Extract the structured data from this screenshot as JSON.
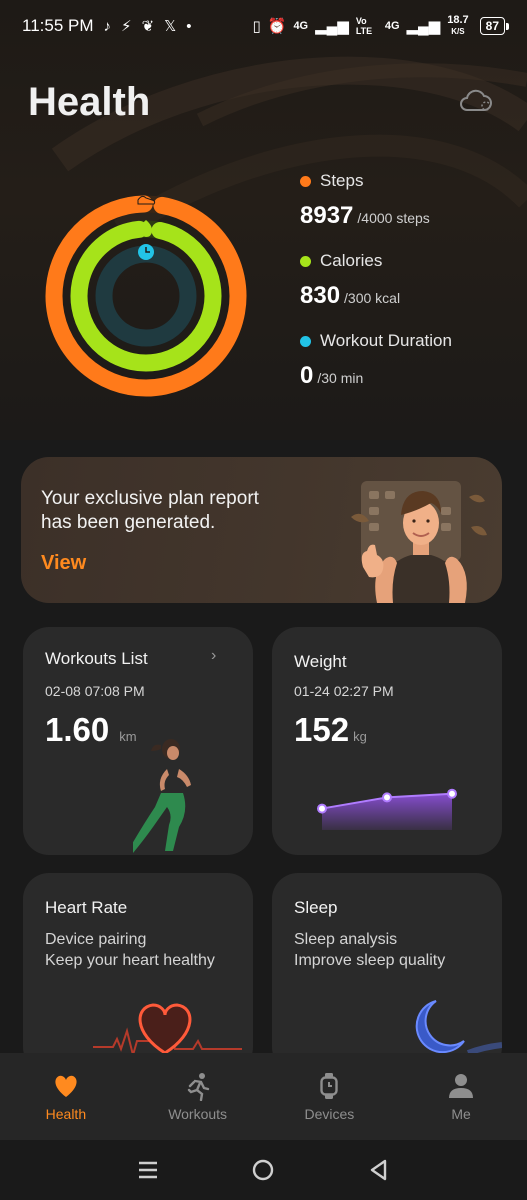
{
  "status_bar": {
    "time": "11:55 PM",
    "left_icons": [
      "tiktok-icon",
      "bolt-icon",
      "leaf-icon",
      "x-icon"
    ],
    "dot": "•",
    "net_4g_a": "4G",
    "volte": "Vo LTE",
    "net_4g_b": "4G",
    "speed": "18.7",
    "speed_unit": "K/S",
    "battery": "87"
  },
  "header": {
    "title": "Health"
  },
  "rings": {
    "steps_color": "#ff7a1a",
    "calories_color": "#a6e31a",
    "workout_color": "#22c3e6",
    "steps_progress": 1.0,
    "calories_progress": 1.0,
    "workout_progress": 0.0
  },
  "metrics": [
    {
      "label": "Steps",
      "value": "8937",
      "goal": "/4000 steps",
      "color": "#ff7a1a"
    },
    {
      "label": "Calories",
      "value": "830",
      "goal": "/300 kcal",
      "color": "#a6e31a"
    },
    {
      "label": "Workout Duration",
      "value": "0",
      "goal": "/30 min",
      "color": "#22c3e6"
    }
  ],
  "banner": {
    "line1": "Your exclusive plan report",
    "line2": "has been generated.",
    "action": "View"
  },
  "cards": {
    "workouts": {
      "title": "Workouts List",
      "date": "02-08 07:08 PM",
      "value": "1.60",
      "unit": "km"
    },
    "weight": {
      "title": "Weight",
      "date": "01-24 02:27 PM",
      "value": "152",
      "unit": "kg",
      "trend": [
        148,
        151,
        152
      ]
    },
    "heart": {
      "title": "Heart Rate",
      "line1": "Device pairing",
      "line2": "Keep your heart healthy"
    },
    "sleep": {
      "title": "Sleep",
      "line1": "Sleep analysis",
      "line2": "Improve sleep quality"
    }
  },
  "nav": [
    {
      "label": "Health",
      "icon": "heart-icon",
      "active": true
    },
    {
      "label": "Workouts",
      "icon": "running-icon",
      "active": false
    },
    {
      "label": "Devices",
      "icon": "watch-icon",
      "active": false
    },
    {
      "label": "Me",
      "icon": "person-icon",
      "active": false
    }
  ],
  "accent": "#ff8a1f"
}
